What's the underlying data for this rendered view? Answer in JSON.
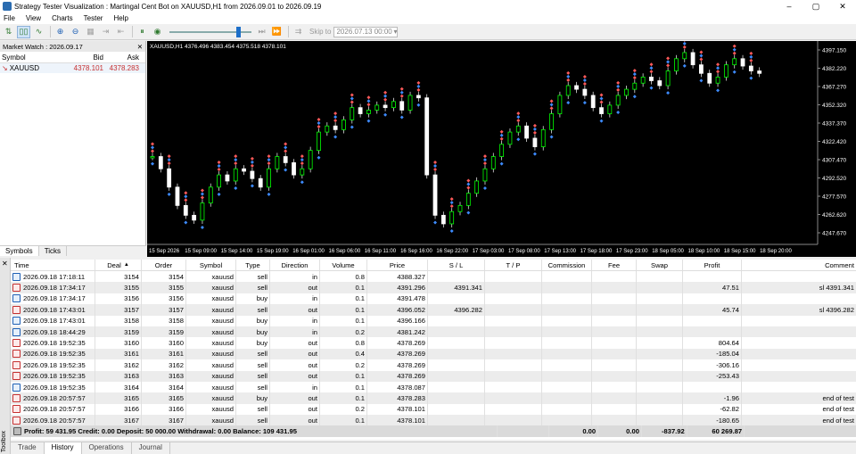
{
  "window": {
    "title": "Strategy Tester Visualization : Martingal Cent Bot on XAUUSD,H1 from 2026.09.01 to 2026.09.19",
    "min": "–",
    "max": "▢",
    "close": "✕"
  },
  "menu": [
    "File",
    "View",
    "Charts",
    "Tester",
    "Help"
  ],
  "toolbar": {
    "skip_label": "Skip to",
    "skip_value": "2026.07.13 00:00",
    "speed_fraction": 0.86
  },
  "market_watch": {
    "title": "Market Watch : 2026.09.17",
    "columns": [
      "Symbol",
      "Bid",
      "Ask"
    ],
    "rows": [
      {
        "symbol": "XAUUSD",
        "bid": "4378.101",
        "ask": "4378.283"
      }
    ],
    "tabs": [
      "Symbols",
      "Ticks"
    ]
  },
  "chart": {
    "info": "XAUUSD,H1  4376.496 4383.454 4375.518 4378.101",
    "price_labels": [
      "4397.150",
      "4382.220",
      "4367.270",
      "4352.320",
      "4337.370",
      "4322.420",
      "4307.470",
      "4292.520",
      "4277.570",
      "4262.620",
      "4247.670"
    ],
    "time_labels": [
      "15 Sep 2026",
      "15 Sep 09:00",
      "15 Sep 14:00",
      "15 Sep 19:00",
      "16 Sep 01:00",
      "16 Sep 06:00",
      "16 Sep 11:00",
      "16 Sep 16:00",
      "16 Sep 22:00",
      "17 Sep 03:00",
      "17 Sep 08:00",
      "17 Sep 13:00",
      "17 Sep 18:00",
      "17 Sep 23:00",
      "18 Sep 05:00",
      "18 Sep 10:00",
      "18 Sep 15:00",
      "18 Sep 20:00"
    ],
    "colors": {
      "bg": "#000000",
      "bull": "#00ff00",
      "bear": "#ffffff",
      "sell_marker": "#ff5a5a",
      "buy_marker": "#3d8bff"
    }
  },
  "history": {
    "columns": [
      "Time",
      "Deal",
      "Order",
      "Symbol",
      "Type",
      "Direction",
      "Volume",
      "Price",
      "S / L",
      "T / P",
      "Commission",
      "Fee",
      "Swap",
      "Profit",
      "Comment"
    ],
    "rows": [
      {
        "time": "2026.09.18 17:18:11",
        "deal": "3154",
        "order": "3154",
        "symbol": "xauusd",
        "type": "sell",
        "direction": "in",
        "volume": "0.8",
        "price": "4388.327",
        "sl": "",
        "tp": "",
        "commission": "",
        "fee": "",
        "swap": "",
        "profit": "",
        "comment": ""
      },
      {
        "time": "2026.09.18 17:34:17",
        "deal": "3155",
        "order": "3155",
        "symbol": "xauusd",
        "type": "sell",
        "direction": "out",
        "volume": "0.1",
        "price": "4391.296",
        "sl": "4391.341",
        "tp": "",
        "commission": "",
        "fee": "",
        "swap": "",
        "profit": "47.51",
        "comment": "sl 4391.341"
      },
      {
        "time": "2026.09.18 17:34:17",
        "deal": "3156",
        "order": "3156",
        "symbol": "xauusd",
        "type": "buy",
        "direction": "in",
        "volume": "0.1",
        "price": "4391.478",
        "sl": "",
        "tp": "",
        "commission": "",
        "fee": "",
        "swap": "",
        "profit": "",
        "comment": ""
      },
      {
        "time": "2026.09.18 17:43:01",
        "deal": "3157",
        "order": "3157",
        "symbol": "xauusd",
        "type": "sell",
        "direction": "out",
        "volume": "0.1",
        "price": "4396.052",
        "sl": "4396.282",
        "tp": "",
        "commission": "",
        "fee": "",
        "swap": "",
        "profit": "45.74",
        "comment": "sl 4396.282"
      },
      {
        "time": "2026.09.18 17:43:01",
        "deal": "3158",
        "order": "3158",
        "symbol": "xauusd",
        "type": "buy",
        "direction": "in",
        "volume": "0.1",
        "price": "4396.166",
        "sl": "",
        "tp": "",
        "commission": "",
        "fee": "",
        "swap": "",
        "profit": "",
        "comment": ""
      },
      {
        "time": "2026.09.18 18:44:29",
        "deal": "3159",
        "order": "3159",
        "symbol": "xauusd",
        "type": "buy",
        "direction": "in",
        "volume": "0.2",
        "price": "4381.242",
        "sl": "",
        "tp": "",
        "commission": "",
        "fee": "",
        "swap": "",
        "profit": "",
        "comment": ""
      },
      {
        "time": "2026.09.18 19:52:35",
        "deal": "3160",
        "order": "3160",
        "symbol": "xauusd",
        "type": "buy",
        "direction": "out",
        "volume": "0.8",
        "price": "4378.269",
        "sl": "",
        "tp": "",
        "commission": "",
        "fee": "",
        "swap": "",
        "profit": "804.64",
        "comment": ""
      },
      {
        "time": "2026.09.18 19:52:35",
        "deal": "3161",
        "order": "3161",
        "symbol": "xauusd",
        "type": "sell",
        "direction": "out",
        "volume": "0.4",
        "price": "4378.269",
        "sl": "",
        "tp": "",
        "commission": "",
        "fee": "",
        "swap": "",
        "profit": "-185.04",
        "comment": ""
      },
      {
        "time": "2026.09.18 19:52:35",
        "deal": "3162",
        "order": "3162",
        "symbol": "xauusd",
        "type": "sell",
        "direction": "out",
        "volume": "0.2",
        "price": "4378.269",
        "sl": "",
        "tp": "",
        "commission": "",
        "fee": "",
        "swap": "",
        "profit": "-306.16",
        "comment": ""
      },
      {
        "time": "2026.09.18 19:52:35",
        "deal": "3163",
        "order": "3163",
        "symbol": "xauusd",
        "type": "sell",
        "direction": "out",
        "volume": "0.1",
        "price": "4378.269",
        "sl": "",
        "tp": "",
        "commission": "",
        "fee": "",
        "swap": "",
        "profit": "-253.43",
        "comment": ""
      },
      {
        "time": "2026.09.18 19:52:35",
        "deal": "3164",
        "order": "3164",
        "symbol": "xauusd",
        "type": "sell",
        "direction": "in",
        "volume": "0.1",
        "price": "4378.087",
        "sl": "",
        "tp": "",
        "commission": "",
        "fee": "",
        "swap": "",
        "profit": "",
        "comment": ""
      },
      {
        "time": "2026.09.18 20:57:57",
        "deal": "3165",
        "order": "3165",
        "symbol": "xauusd",
        "type": "buy",
        "direction": "out",
        "volume": "0.1",
        "price": "4378.283",
        "sl": "",
        "tp": "",
        "commission": "",
        "fee": "",
        "swap": "",
        "profit": "-1.96",
        "comment": "end of test"
      },
      {
        "time": "2026.09.18 20:57:57",
        "deal": "3166",
        "order": "3166",
        "symbol": "xauusd",
        "type": "sell",
        "direction": "out",
        "volume": "0.2",
        "price": "4378.101",
        "sl": "",
        "tp": "",
        "commission": "",
        "fee": "",
        "swap": "",
        "profit": "-62.82",
        "comment": "end of test"
      },
      {
        "time": "2026.09.18 20:57:57",
        "deal": "3167",
        "order": "3167",
        "symbol": "xauusd",
        "type": "sell",
        "direction": "out",
        "volume": "0.1",
        "price": "4378.101",
        "sl": "",
        "tp": "",
        "commission": "",
        "fee": "",
        "swap": "",
        "profit": "-180.65",
        "comment": "end of test"
      }
    ],
    "totals": {
      "summary": "Profit: 59 431.95   Credit: 0.00   Deposit: 50 000.00   Withdrawal: 0.00   Balance: 109 431.95",
      "commission": "0.00",
      "fee": "0.00",
      "swap": "-837.92",
      "profit": "60 269.87"
    }
  },
  "toolbox_label": "Toolbox",
  "bottom_tabs": [
    "Trade",
    "History",
    "Operations",
    "Journal"
  ]
}
